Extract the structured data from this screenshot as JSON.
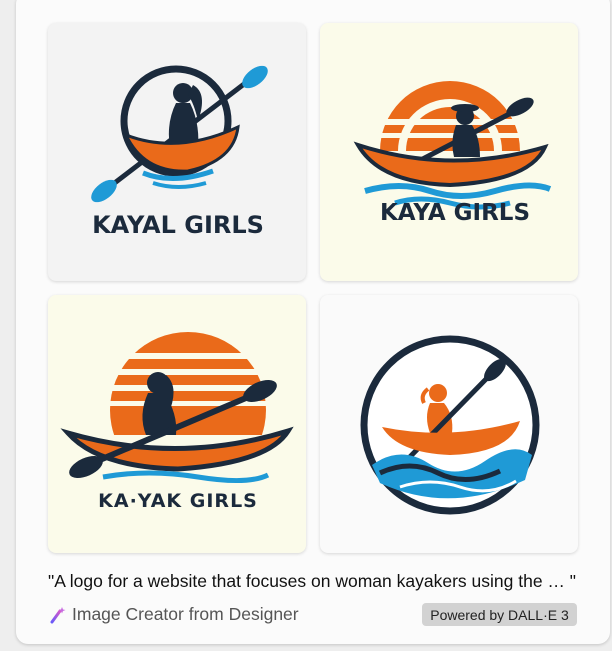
{
  "images": [
    {
      "logo_text": "KAYAL GIRLS"
    },
    {
      "logo_text": "KAYA GIRLS"
    },
    {
      "logo_text": "KA·YAK GIRLS"
    },
    {
      "logo_text": ""
    }
  ],
  "caption": "\"A logo for a website that focuses on woman kayakers using the … \"",
  "creator": {
    "icon": "wand-icon",
    "label": "Image Creator from Designer"
  },
  "badge": {
    "label": "Powered by DALL·E 3"
  },
  "colors": {
    "orange": "#ea6a1a",
    "navy": "#1b2a3c",
    "blue": "#1f9ad6",
    "badge_bg": "#d2d2d2"
  }
}
